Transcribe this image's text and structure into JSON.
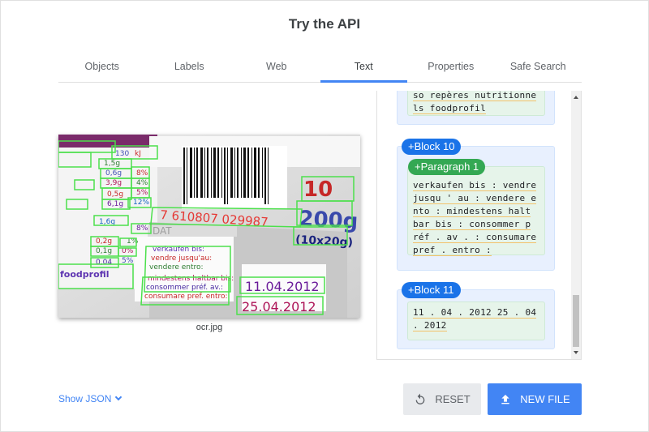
{
  "header": {
    "title": "Try the API"
  },
  "tabs": [
    {
      "label": "Objects"
    },
    {
      "label": "Labels"
    },
    {
      "label": "Web"
    },
    {
      "label": "Text",
      "active": true
    },
    {
      "label": "Properties"
    },
    {
      "label": "Safe Search"
    }
  ],
  "image": {
    "caption": "ocr.jpg",
    "texts": {
      "l1": "10",
      "l2": "200g",
      "l3": "(10x20g)",
      "barcode": "7 610807 029987",
      "dat": "DAT",
      "date1": "11.04.2012",
      "date2": "25.04.2012",
      "vk1": "verkaufen bis:",
      "vk2": "vendre jusqu'au:",
      "vk3": "vendere entro:",
      "vk4": "mindestens haltbar bis:",
      "vk5": "consommer préf. av.:",
      "vk6": "consumare pref. entro:",
      "nut1": "130",
      "nut2": "kJ",
      "nut3": "8%",
      "nut4": "4%",
      "nut5": "5%",
      "nut6": "12%",
      "nut7": "8%",
      "nut8": "0,2g",
      "nut9": "0,1g",
      "nut10": "0%",
      "nut11": "5%",
      "nut12": "0,04",
      "nut13": "foodprofil",
      "nut14": "1,6g",
      "nut15": "1,5g",
      "nut16": "0,5g",
      "nut17": "6,1g",
      "nut18": "0,6g",
      "nut19": "3,9g",
      "nut20": "1%"
    }
  },
  "results": {
    "top_lines": [
      "so repères nutritionne",
      "ls foodprofil"
    ],
    "block10": {
      "label": "+Block 10",
      "paragraph_label": "+Paragraph 1",
      "lines": [
        "verkaufen bis : vendre",
        "jusqu ' au : vendere e",
        "nto : mindestens halt",
        "bar bis : consommer p",
        "réf . av . : consumare",
        "pref . entro :"
      ]
    },
    "block11": {
      "label": "+Block 11",
      "lines": [
        "11 . 04 . 2012 25 . 04",
        ". 2012"
      ]
    }
  },
  "footer": {
    "show_json": "Show JSON",
    "reset_label": "RESET",
    "new_file_label": "NEW FILE"
  },
  "colors": {
    "accent": "#4285f4",
    "block": "#1a73e8",
    "paragraph": "#34a853",
    "detect_box": "#4ce04c"
  }
}
